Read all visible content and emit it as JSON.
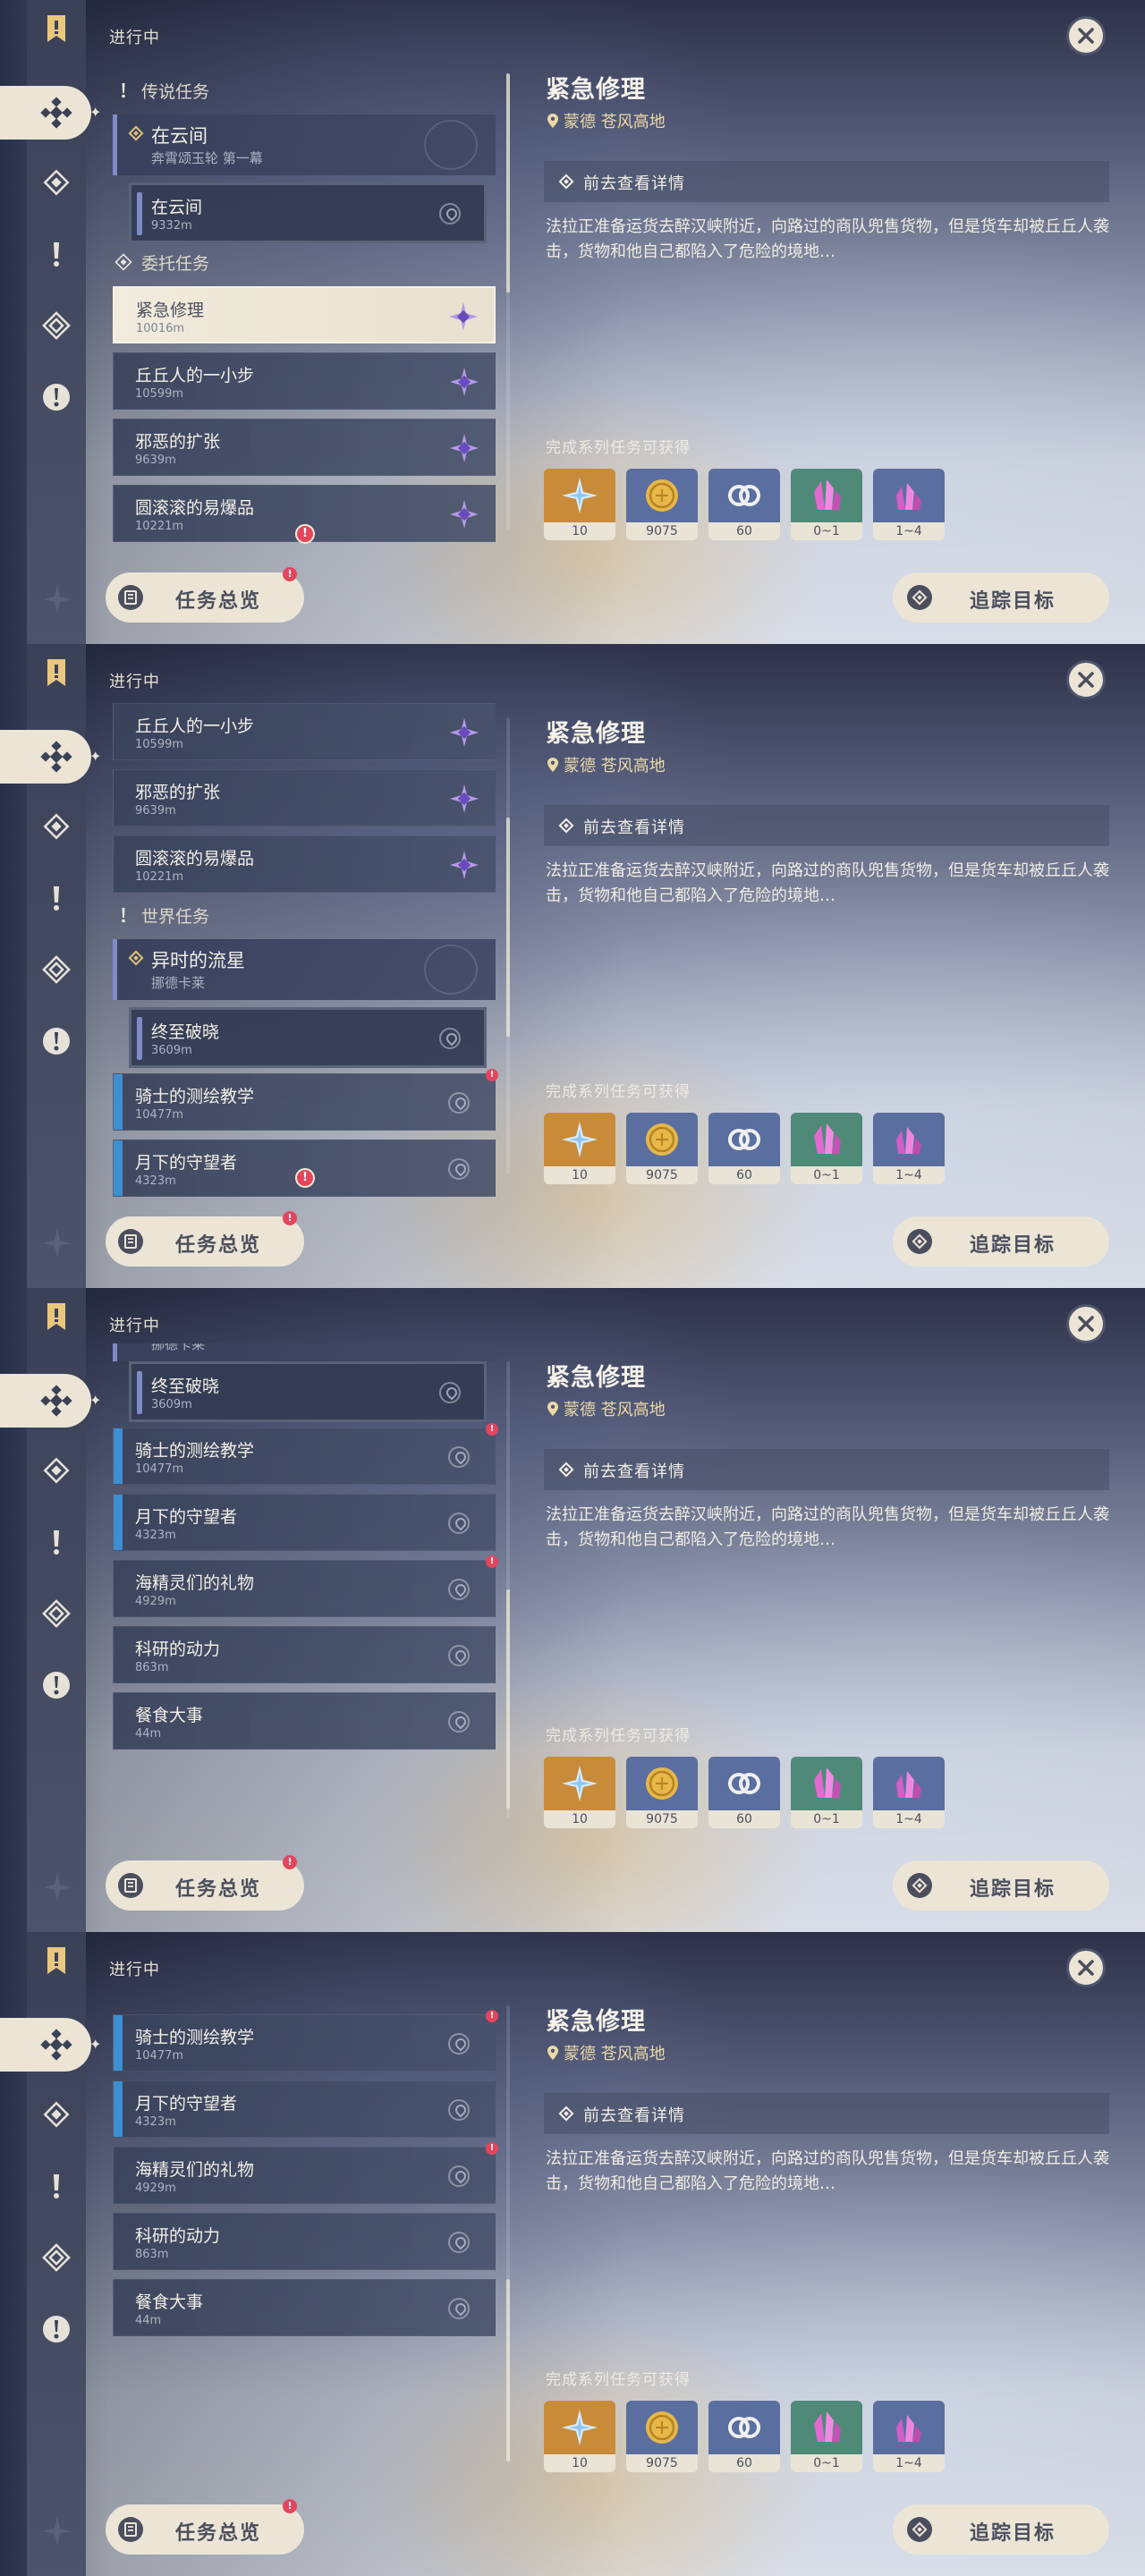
{
  "frames": [
    {
      "list_scroll": 0,
      "scroll_thumb": {
        "start": 0.0,
        "size": 0.48
      },
      "items": [
        {
          "kind": "category",
          "text": "传说任务",
          "icon": "exclamation-icon"
        },
        {
          "kind": "group",
          "title": "在云间",
          "sub": "奔霄颂玉轮 第一幕",
          "icon": "diamond-icon"
        },
        {
          "kind": "sub",
          "title": "在云间",
          "dist": "9332m",
          "stripe": false
        },
        {
          "kind": "category",
          "text": "委托任务",
          "icon": "compass-icon"
        },
        {
          "kind": "quest",
          "title": "紧急修理",
          "dist": "10016m",
          "selected": true,
          "type_icon": true
        },
        {
          "kind": "quest",
          "title": "丘丘人的一小步",
          "dist": "10599m",
          "type_icon": true
        },
        {
          "kind": "quest",
          "title": "邪恶的扩张",
          "dist": "9639m",
          "type_icon": true
        },
        {
          "kind": "quest",
          "title": "圆滚滚的易爆品",
          "dist": "10221m",
          "type_icon": true
        }
      ],
      "hint_dot": {
        "visible": true
      }
    },
    {
      "list_scroll": 1,
      "scroll_thumb": {
        "start": 0.22,
        "size": 0.48
      },
      "items": [
        {
          "kind": "quest",
          "title": "丘丘人的一小步",
          "dist": "10599m",
          "type_icon": true
        },
        {
          "kind": "quest",
          "title": "邪恶的扩张",
          "dist": "9639m",
          "type_icon": true
        },
        {
          "kind": "quest",
          "title": "圆滚滚的易爆品",
          "dist": "10221m",
          "type_icon": true
        },
        {
          "kind": "category",
          "text": "世界任务",
          "icon": "exclamation-icon"
        },
        {
          "kind": "group",
          "title": "异时的流星",
          "sub": "挪德卡莱",
          "icon": "diamond-icon"
        },
        {
          "kind": "sub",
          "title": "终至破晓",
          "dist": "3609m",
          "stripe": true
        },
        {
          "kind": "quest",
          "title": "骑士的测绘教学",
          "dist": "10477m",
          "stripe": true,
          "alert": true
        },
        {
          "kind": "quest",
          "title": "月下的守望者",
          "dist": "4323m",
          "stripe": true
        }
      ],
      "hint_dot": {
        "visible": true
      }
    },
    {
      "list_scroll": 2,
      "scroll_thumb": {
        "start": 0.5,
        "size": 0.48
      },
      "items": [
        {
          "kind": "partial-group",
          "sub": "挪德卡莱"
        },
        {
          "kind": "sub",
          "title": "终至破晓",
          "dist": "3609m",
          "stripe": true
        },
        {
          "kind": "quest",
          "title": "骑士的测绘教学",
          "dist": "10477m",
          "stripe": true,
          "alert": true
        },
        {
          "kind": "quest",
          "title": "月下的守望者",
          "dist": "4323m",
          "stripe": true
        },
        {
          "kind": "quest",
          "title": "海精灵们的礼物",
          "dist": "4929m",
          "alert": true
        },
        {
          "kind": "quest",
          "title": "科研的动力",
          "dist": "863m"
        },
        {
          "kind": "quest",
          "title": "餐食大事",
          "dist": "44m"
        }
      ],
      "hint_dot": {
        "visible": false
      }
    },
    {
      "list_scroll": 3,
      "scroll_thumb": {
        "start": 0.6,
        "size": 0.4
      },
      "items": [
        {
          "kind": "quest",
          "title": "骑士的测绘教学",
          "dist": "10477m",
          "stripe": true,
          "alert": true
        },
        {
          "kind": "quest",
          "title": "月下的守望者",
          "dist": "4323m",
          "stripe": true
        },
        {
          "kind": "quest",
          "title": "海精灵们的礼物",
          "dist": "4929m",
          "alert": true
        },
        {
          "kind": "quest",
          "title": "科研的动力",
          "dist": "863m"
        },
        {
          "kind": "quest",
          "title": "餐食大事",
          "dist": "44m"
        }
      ],
      "hint_dot": {
        "visible": false
      }
    }
  ],
  "ui": {
    "status": "进行中",
    "overview_label": "任务总览",
    "overview_alert": "!",
    "track_label": "追踪目标",
    "hint_symbol": "!"
  },
  "detail": {
    "title": "紧急修理",
    "location": "蒙德 苍风高地",
    "nav_label": "前去查看详情",
    "description": "法拉正准备运货去醉汉峡附近，向路过的商队兜售货物，但是货车却被丘丘人袭击，货物和他自己都陷入了危险的境地…",
    "rewards_label": "完成系列任务可获得",
    "rewards": [
      {
        "item": "primogem-icon",
        "amount": "10",
        "bg": "#c88b3a"
      },
      {
        "item": "mora-icon",
        "amount": "9075",
        "bg": "#5a6fa0"
      },
      {
        "item": "adventure-exp-icon",
        "amount": "60",
        "bg": "#5a6fa0"
      },
      {
        "item": "crystal-chunk-icon",
        "amount": "0~1",
        "bg": "#4f8a78"
      },
      {
        "item": "crystal-cluster-icon",
        "amount": "1~4",
        "bg": "#5a6fa0"
      }
    ]
  },
  "colors": {
    "accent_cream": "#ece5d6",
    "panel_dark": "#3a435c",
    "alert_red": "#e5455c",
    "stripe_blue": "#3d8fd0",
    "location_gold": "#ecd9a6",
    "commission_purple": "#8a6ad6"
  }
}
